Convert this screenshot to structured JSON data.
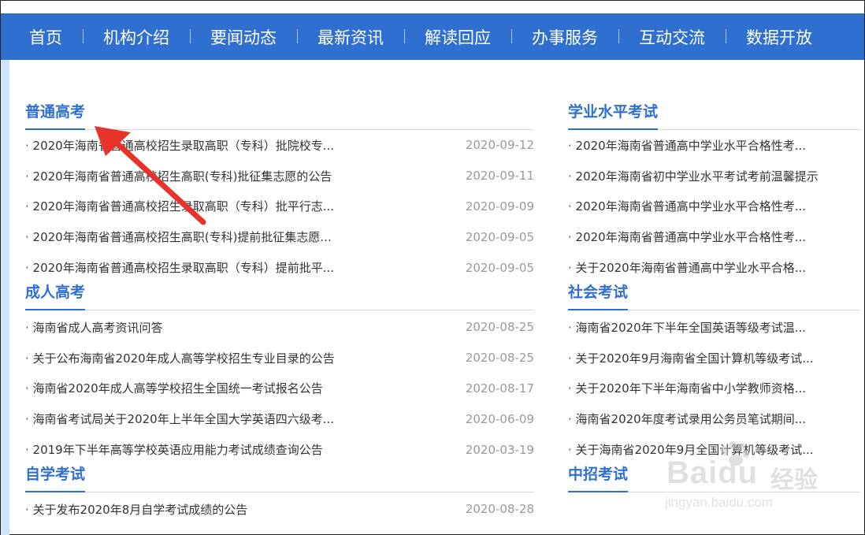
{
  "nav": {
    "items": [
      "首页",
      "机构介绍",
      "要闻动态",
      "最新资讯",
      "解读回应",
      "办事服务",
      "互动交流",
      "数据开放"
    ]
  },
  "left": {
    "sections": [
      {
        "title": "普通高考",
        "items": [
          {
            "title": "2020年海南省普通高校招生录取高职（专科）批院校专...",
            "date": "2020-09-12"
          },
          {
            "title": "2020年海南省普通高校招生高职(专科)批征集志愿的公告",
            "date": "2020-09-11"
          },
          {
            "title": "2020年海南省普通高校招生录取高职（专科）批平行志...",
            "date": "2020-09-09"
          },
          {
            "title": "2020年海南省普通高校招生高职(专科)提前批征集志愿...",
            "date": "2020-09-05"
          },
          {
            "title": "2020年海南省普通高校招生录取高职（专科）提前批平...",
            "date": "2020-09-05"
          }
        ]
      },
      {
        "title": "成人高考",
        "items": [
          {
            "title": "海南省成人高考资讯问答",
            "date": "2020-08-25"
          },
          {
            "title": "关于公布海南省2020年成人高等学校招生专业目录的公告",
            "date": "2020-08-25"
          },
          {
            "title": "海南省2020年成人高等学校招生全国统一考试报名公告",
            "date": "2020-08-17"
          },
          {
            "title": "海南省考试局关于2020年上半年全国大学英语四六级考...",
            "date": "2020-06-09"
          },
          {
            "title": "2019年下半年高等学校英语应用能力考试成绩查询公告",
            "date": "2020-03-19"
          }
        ]
      },
      {
        "title": "自学考试",
        "items": [
          {
            "title": "关于发布2020年8月自学考试成绩的公告",
            "date": "2020-08-28"
          }
        ]
      }
    ]
  },
  "right": {
    "sections": [
      {
        "title": "学业水平考试",
        "items": [
          {
            "title": "2020年海南省普通高中学业水平合格性考..."
          },
          {
            "title": "2020年海南省初中学业水平考试考前温馨提示"
          },
          {
            "title": "2020年海南省普通高中学业水平合格性考..."
          },
          {
            "title": "2020年海南省普通高中学业水平合格性考..."
          },
          {
            "title": "关于2020年海南省普通高中学业水平合格..."
          }
        ]
      },
      {
        "title": "社会考试",
        "items": [
          {
            "title": "海南省2020年下半年全国英语等级考试温..."
          },
          {
            "title": "关于2020年9月海南省全国计算机等级考试..."
          },
          {
            "title": "关于2020年下半年海南省中小学教师资格..."
          },
          {
            "title": "海南省2020年度考试录用公务员笔试期间..."
          },
          {
            "title": "关于海南省2020年9月全国计算机等级考试..."
          }
        ]
      },
      {
        "title": "中招考试",
        "items": []
      }
    ]
  },
  "watermark": {
    "logo": "Baidu",
    "cn": "经验",
    "url": "jingyan.baidu.com"
  },
  "colors": {
    "nav_bg": "#2f6fd0",
    "accent": "#2f6fd0",
    "arrow": "#e8332a",
    "left_bar": "#cfe3fa"
  }
}
